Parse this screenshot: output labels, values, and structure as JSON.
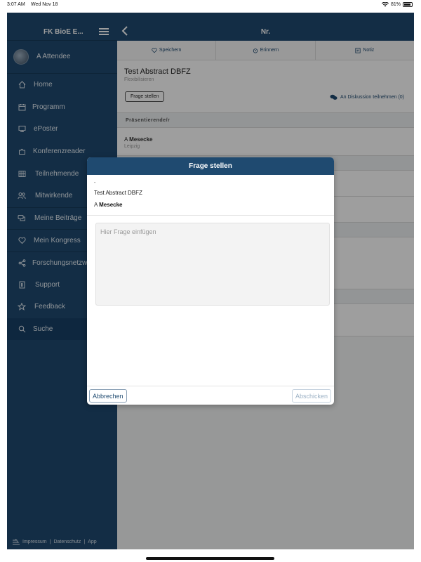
{
  "status_bar": {
    "time": "3:07 AM",
    "date": "Wed Nov 18",
    "battery": "81%"
  },
  "sidebar": {
    "app_title": "FK BioE E...",
    "user_name": "A Attendee",
    "items": [
      {
        "label": "Home",
        "icon": "home-icon"
      },
      {
        "label": "Programm",
        "icon": "calendar-icon"
      },
      {
        "label": "ePoster",
        "icon": "monitor-icon"
      },
      {
        "label": "Konferenzreader",
        "icon": "puzzle-icon"
      },
      {
        "label": "Teilnehmende",
        "icon": "people-grid-icon"
      },
      {
        "label": "Mitwirkende",
        "icon": "group-icon"
      },
      {
        "label": "Meine Beiträge",
        "icon": "chat-icon"
      },
      {
        "label": "Mein Kongress",
        "icon": "heart-icon"
      },
      {
        "label": "Forschungsnetzwerk",
        "icon": "share-icon"
      },
      {
        "label": "Support",
        "icon": "building-icon"
      },
      {
        "label": "Feedback",
        "icon": "star-icon"
      },
      {
        "label": "Suche",
        "icon": "search-icon"
      }
    ],
    "footer": {
      "impressum": "Impressum",
      "sep1": "|",
      "datenschutz": "Datenschutz",
      "sep2": "|",
      "app": "App"
    }
  },
  "header": {
    "title": "Nr."
  },
  "toolbar": {
    "save": "Speichern",
    "remind": "Erinnern",
    "note": "Notiz"
  },
  "detail": {
    "title": "Test Abstract DBFZ",
    "subtitle": "Flexibilisieren",
    "ask_button": "Frage stellen",
    "join_discussion": "An Diskussion teilnehmen (0)"
  },
  "presenters": {
    "heading": "Präsentierende/r",
    "name_initial": "A",
    "name": "Mesecke",
    "city": "Leipzig"
  },
  "modal": {
    "title": "Frage stellen",
    "dash": "-",
    "abstract_title": "Test Abstract DBFZ",
    "author_initial": "A",
    "author_name": "Mesecke",
    "question_placeholder": "Hier Frage einfügen",
    "cancel": "Abbrechen",
    "send": "Abschicken"
  },
  "colors": {
    "primary": "#1f4a70",
    "overlay": "rgba(0,0,0,0.38)"
  }
}
